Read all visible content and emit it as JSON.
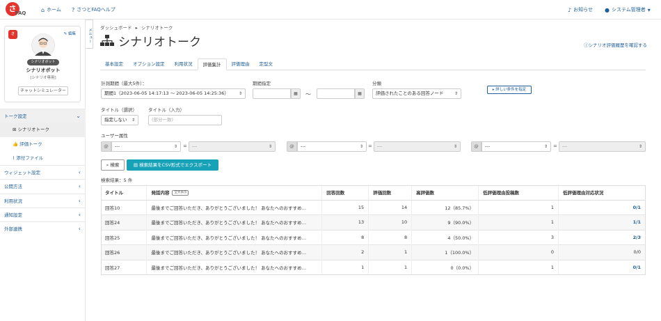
{
  "header": {
    "logo_text": "FAQ",
    "logo_mark": "さ",
    "nav_home": "ホーム",
    "nav_help": "さつとFAQヘルプ",
    "notice": "お知らせ",
    "user": "システム管理者"
  },
  "menu_toggle": "メニュー",
  "bot": {
    "badge": "さ",
    "edit": "編集",
    "tag": "シナリオボット",
    "name": "シナリオボット",
    "role": "[シナリオ専用]",
    "simulator": "チャットシミュレーター"
  },
  "sidebar": {
    "items": [
      {
        "label": "トーク設定"
      },
      {
        "label": "シナリオトーク"
      },
      {
        "label": "評価トーク"
      },
      {
        "label": "添付ファイル"
      },
      {
        "label": "ウィジェット設定"
      },
      {
        "label": "公開方法"
      },
      {
        "label": "利用状況"
      },
      {
        "label": "通知設定"
      },
      {
        "label": "外部連携"
      }
    ]
  },
  "breadcrumb": {
    "root": "ダッシュボード",
    "sep": "▸",
    "current": "シナリオトーク"
  },
  "page_title": "シナリオトーク",
  "history_link": "シナリオ評価履歴を確認する",
  "tabs": [
    {
      "label": "基本設定"
    },
    {
      "label": "オプション設定"
    },
    {
      "label": "利用状況"
    },
    {
      "label": "評価集計"
    },
    {
      "label": "評価理由"
    },
    {
      "label": "定型文"
    }
  ],
  "filters": {
    "period_label": "計測期間（最大5件）：",
    "period_value": "期間1（2023-06-05 14:17:13 〜 2023-06-05 14:25:36）",
    "range_label": "期間指定",
    "range_sep": "〜",
    "category_label": "分類",
    "category_value": "評価されたことのある回答ノード",
    "detail_button": "詳しい条件を指定",
    "title_select_label": "タイトル（選択）",
    "title_select_value": "指定しない",
    "title_input_label": "タイトル（入力）",
    "title_input_placeholder": "(部分一致)",
    "user_attr_label": "ユーザー属性",
    "attr_value": "---",
    "attr_op": "="
  },
  "search_button": "検索",
  "export_button": "検索結果をCSV形式でエクスポート",
  "result_count": "検索結果：5 件",
  "table": {
    "headers": [
      "タイトル",
      "発話内容",
      "回答回数",
      "評価回数",
      "高評価数",
      "低評価理由投稿数",
      "低評価理由対応状況"
    ],
    "full_badge": "全文表示",
    "rows": [
      [
        "回答10",
        "最後までご回答いただき、ありがとうございました！ あなたへのおすすめ…",
        "15",
        "14",
        "12（85.7%）",
        "1",
        "0/1"
      ],
      [
        "回答24",
        "最後までご回答いただき、ありがとうございました！ あなたへのおすすめ…",
        "13",
        "10",
        "9（90.0%）",
        "1",
        "1/1"
      ],
      [
        "回答25",
        "最後までご回答いただき、ありがとうございました！ あなたへのおすすめ…",
        "8",
        "8",
        "4（50.0%）",
        "3",
        "2/3"
      ],
      [
        "回答26",
        "最後までご回答いただき、ありがとうございました！ あなたへのおすすめ…",
        "2",
        "1",
        "1（100.0%）",
        "0",
        "0/0"
      ],
      [
        "回答27",
        "最後までご回答いただき、ありがとうございました！ あなたへのおすすめ…",
        "1",
        "1",
        "0（0.0%）",
        "1",
        "0/1"
      ]
    ]
  },
  "colors": {
    "accent": "#1f5f9a",
    "export": "#17a2b8",
    "logo": "#e2342c"
  }
}
